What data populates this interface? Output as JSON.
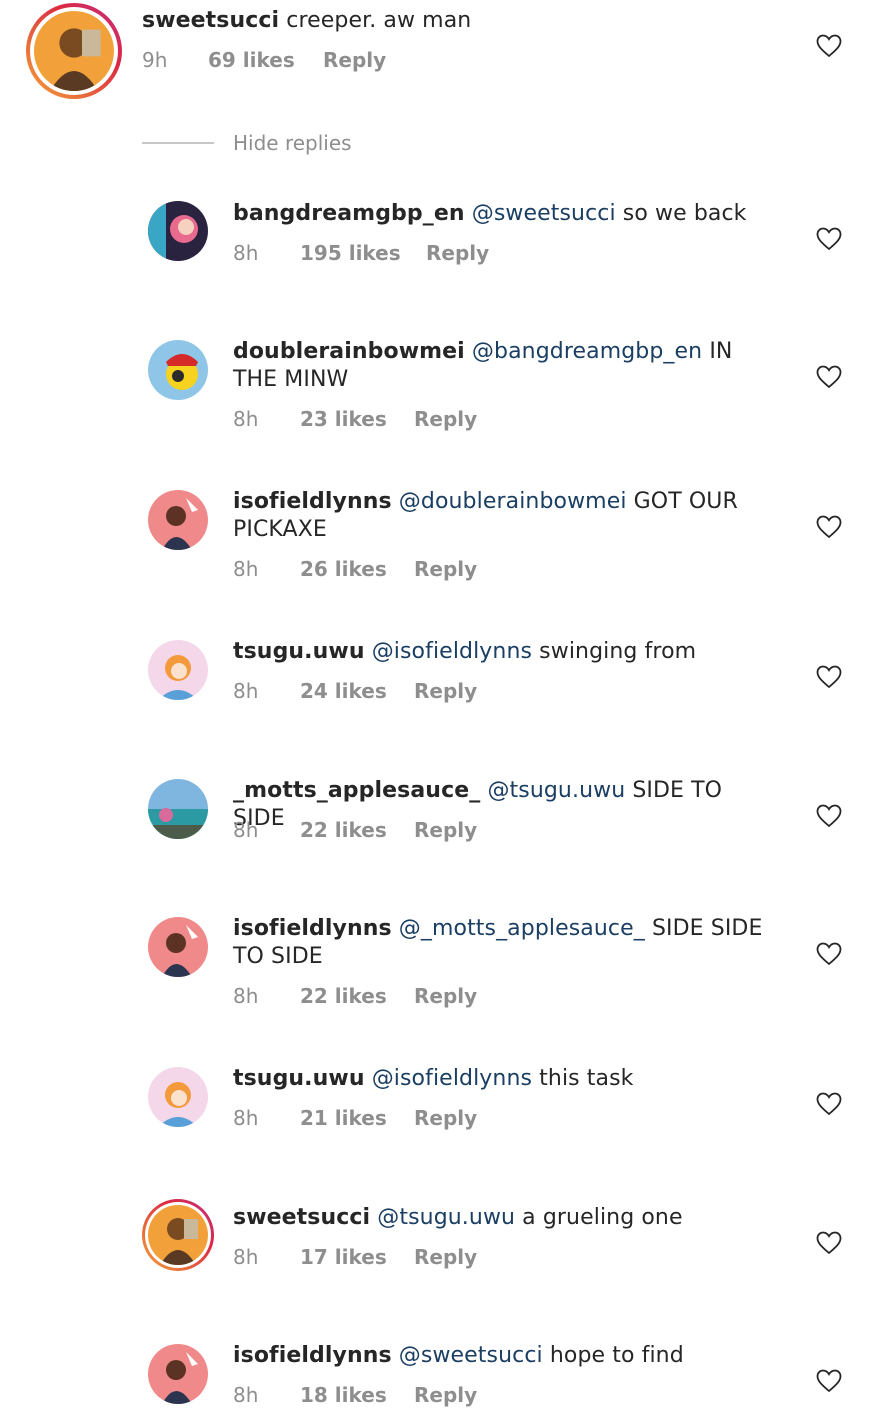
{
  "top_comment": {
    "username": "sweetsucci",
    "text": "creeper. aw man",
    "time": "9h",
    "likes": "69 likes",
    "reply_label": "Reply"
  },
  "hide_replies_label": "Hide replies",
  "replies": [
    {
      "username": "bangdreamgbp_en",
      "mention": "@sweetsucci",
      "text": "so we back",
      "time": "8h",
      "likes": "195 likes",
      "reply_label": "Reply"
    },
    {
      "username": "doublerainbowmei",
      "mention": "@bangdreamgbp_en",
      "text": "IN THE MINW",
      "time": "8h",
      "likes": "23 likes",
      "reply_label": "Reply"
    },
    {
      "username": "isofieldlynns",
      "mention": "@doublerainbowmei",
      "text": "GOT OUR PICKAXE",
      "time": "8h",
      "likes": "26 likes",
      "reply_label": "Reply"
    },
    {
      "username": "tsugu.uwu",
      "mention": "@isofieldlynns",
      "text": "swinging from",
      "time": "8h",
      "likes": "24 likes",
      "reply_label": "Reply"
    },
    {
      "username": "_motts_applesauce_",
      "mention": "@tsugu.uwu",
      "text": "SIDE TO SIDE",
      "time": "8h",
      "likes": "22 likes",
      "reply_label": "Reply"
    },
    {
      "username": "isofieldlynns",
      "mention": "@_motts_applesauce_",
      "text": "SIDE SIDE TO SIDE",
      "time": "8h",
      "likes": "22 likes",
      "reply_label": "Reply"
    },
    {
      "username": "tsugu.uwu",
      "mention": "@isofieldlynns",
      "text": "this task",
      "time": "8h",
      "likes": "21 likes",
      "reply_label": "Reply"
    },
    {
      "username": "sweetsucci",
      "mention": "@tsugu.uwu",
      "text": "a grueling one",
      "time": "8h",
      "likes": "17 likes",
      "reply_label": "Reply"
    },
    {
      "username": "isofieldlynns",
      "mention": "@sweetsucci",
      "text": "hope to find",
      "time": "8h",
      "likes": "18 likes",
      "reply_label": "Reply"
    }
  ],
  "icons": {
    "like": "heart-outline-icon"
  },
  "colors": {
    "mention": "#1b3e63",
    "meta": "#8e8e8e",
    "story_ring_start": "#f9a13a",
    "story_ring_end": "#c13584"
  }
}
